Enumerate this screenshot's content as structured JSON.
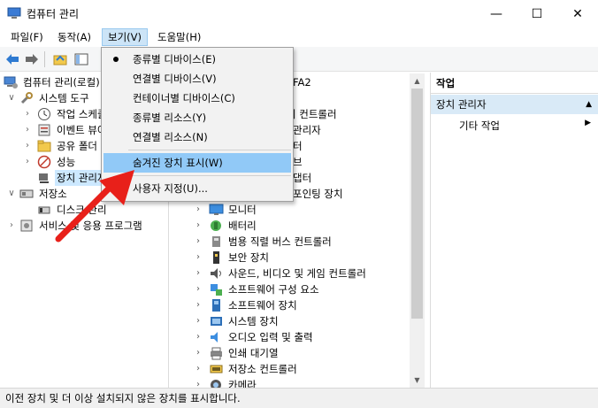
{
  "window": {
    "title": "컴퓨터 관리",
    "minimize_glyph": "—",
    "maximize_glyph": "☐",
    "close_glyph": "✕"
  },
  "menubar": {
    "items": [
      {
        "label": "파일(F)"
      },
      {
        "label": "동작(A)"
      },
      {
        "label": "보기(V)"
      },
      {
        "label": "도움말(H)"
      }
    ]
  },
  "toolbar": {
    "icons": [
      "back-icon",
      "forward-icon",
      "up-folder-icon",
      "show-hide-tree-icon"
    ]
  },
  "left_tree": {
    "items": [
      {
        "label": "컴퓨터 관리(로컬)",
        "icon": "computer-management-icon"
      },
      {
        "label": "시스템 도구",
        "icon": "tools-icon",
        "chevron": "∨"
      },
      {
        "label": "작업 스케줄러",
        "icon": "clock-icon",
        "chevron": "›"
      },
      {
        "label": "이벤트 뷰어",
        "icon": "event-viewer-icon",
        "chevron": "›"
      },
      {
        "label": "공유 폴더",
        "icon": "shared-folder-icon",
        "chevron": "›"
      },
      {
        "label": "성능",
        "icon": "performance-icon",
        "chevron": "›"
      },
      {
        "label": "장치 관리자",
        "icon": "device-manager-icon"
      },
      {
        "label": "저장소",
        "icon": "storage-icon",
        "chevron": "∨"
      },
      {
        "label": "디스크 관리",
        "icon": "disk-icon"
      },
      {
        "label": "서비스 및 응용 프로그램",
        "icon": "services-icon",
        "chevron": "›"
      }
    ]
  },
  "device_list": {
    "root_partial": "FA2",
    "partial_items": [
      {
        "label": "이 컨트롤러"
      },
      {
        "label": "관리자"
      },
      {
        "label": "터"
      },
      {
        "label": "브"
      },
      {
        "label": "댑터"
      },
      {
        "label": "포인팅 장치"
      }
    ],
    "items": [
      {
        "label": "모니터",
        "icon": "monitor-icon"
      },
      {
        "label": "배터리",
        "icon": "battery-icon"
      },
      {
        "label": "범용 직렬 버스 컨트롤러",
        "icon": "usb-icon"
      },
      {
        "label": "보안 장치",
        "icon": "security-device-icon"
      },
      {
        "label": "사운드, 비디오 및 게임 컨트롤러",
        "icon": "sound-icon"
      },
      {
        "label": "소프트웨어 구성 요소",
        "icon": "software-component-icon"
      },
      {
        "label": "소프트웨어 장치",
        "icon": "software-device-icon"
      },
      {
        "label": "시스템 장치",
        "icon": "system-device-icon"
      },
      {
        "label": "오디오 입력 및 출력",
        "icon": "audio-io-icon"
      },
      {
        "label": "인쇄 대기열",
        "icon": "print-queue-icon"
      },
      {
        "label": "저장소 컨트롤러",
        "icon": "storage-controller-icon"
      },
      {
        "label": "카메라",
        "icon": "camera-icon"
      }
    ]
  },
  "actions_pane": {
    "header": "작업",
    "section": "장치 관리자",
    "item": "기타 작업"
  },
  "view_menu": {
    "items": [
      {
        "label": "종류별 디바이스(E)",
        "checked": true
      },
      {
        "label": "연결별 디바이스(V)"
      },
      {
        "label": "컨테이너별 디바이스(C)"
      },
      {
        "label": "종류별 리소스(Y)"
      },
      {
        "label": "연결별 리소스(N)"
      },
      {
        "label": "숨겨진 장치 표시(W)",
        "highlighted": true
      },
      {
        "label": "사용자 지정(U)..."
      }
    ]
  },
  "statusbar": {
    "text": "이전 장치 및 더 이상 설치되지 않은 장치를 표시합니다."
  },
  "colors": {
    "menu_active": "#cce4f7",
    "menu_hover": "#91c9f7",
    "annotation_arrow": "#e8201a"
  }
}
